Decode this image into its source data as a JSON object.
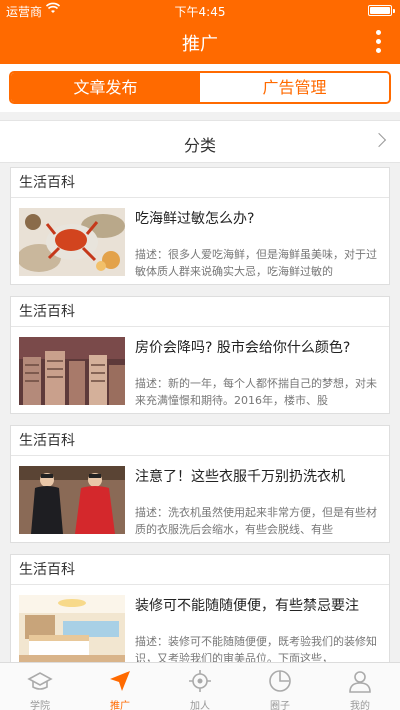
{
  "status_bar": {
    "carrier": "运营商",
    "time": "下午4:45",
    "battery_level": 1.0
  },
  "nav": {
    "title": "推广"
  },
  "segment": {
    "tabs": [
      "文章发布",
      "广告管理"
    ],
    "active_index": 0
  },
  "category_row": {
    "label": "分类"
  },
  "articles": [
    {
      "category": "生活百科",
      "title": "吃海鲜过敏怎么办?",
      "description": "描述：很多人爱吃海鲜，但是海鲜虽美味，对于过敏体质人群来说确实大忌，吃海鲜过敏的"
    },
    {
      "category": "生活百科",
      "title": "房价会降吗? 股市会给你什么颜色?",
      "description": "描述：新的一年，每个人都怀揣自己的梦想，对未来充满憧憬和期待。2016年，楼市、股"
    },
    {
      "category": "生活百科",
      "title": "注意了！这些衣服千万别扔洗衣机",
      "description": "描述：洗衣机虽然使用起来非常方便，但是有些材质的衣服洗后会缩水，有些会脱线、有些"
    },
    {
      "category": "生活百科",
      "title": "装修可不能随随便便，有些禁忌要注",
      "description": "描述：装修可不能随随便便，既考验我们的装修知识，又考验我们的审美品位。下面这些，"
    }
  ],
  "tab_bar": {
    "tabs": [
      {
        "label": "学院",
        "icon": "academy-icon"
      },
      {
        "label": "推广",
        "icon": "promote-icon"
      },
      {
        "label": "加人",
        "icon": "add-people-icon"
      },
      {
        "label": "圈子",
        "icon": "circle-icon"
      },
      {
        "label": "我的",
        "icon": "profile-icon"
      }
    ],
    "active_index": 1
  },
  "colors": {
    "accent": "#ff6a00",
    "background": "#f1f1f1",
    "text": "#333333",
    "muted": "#999999"
  }
}
